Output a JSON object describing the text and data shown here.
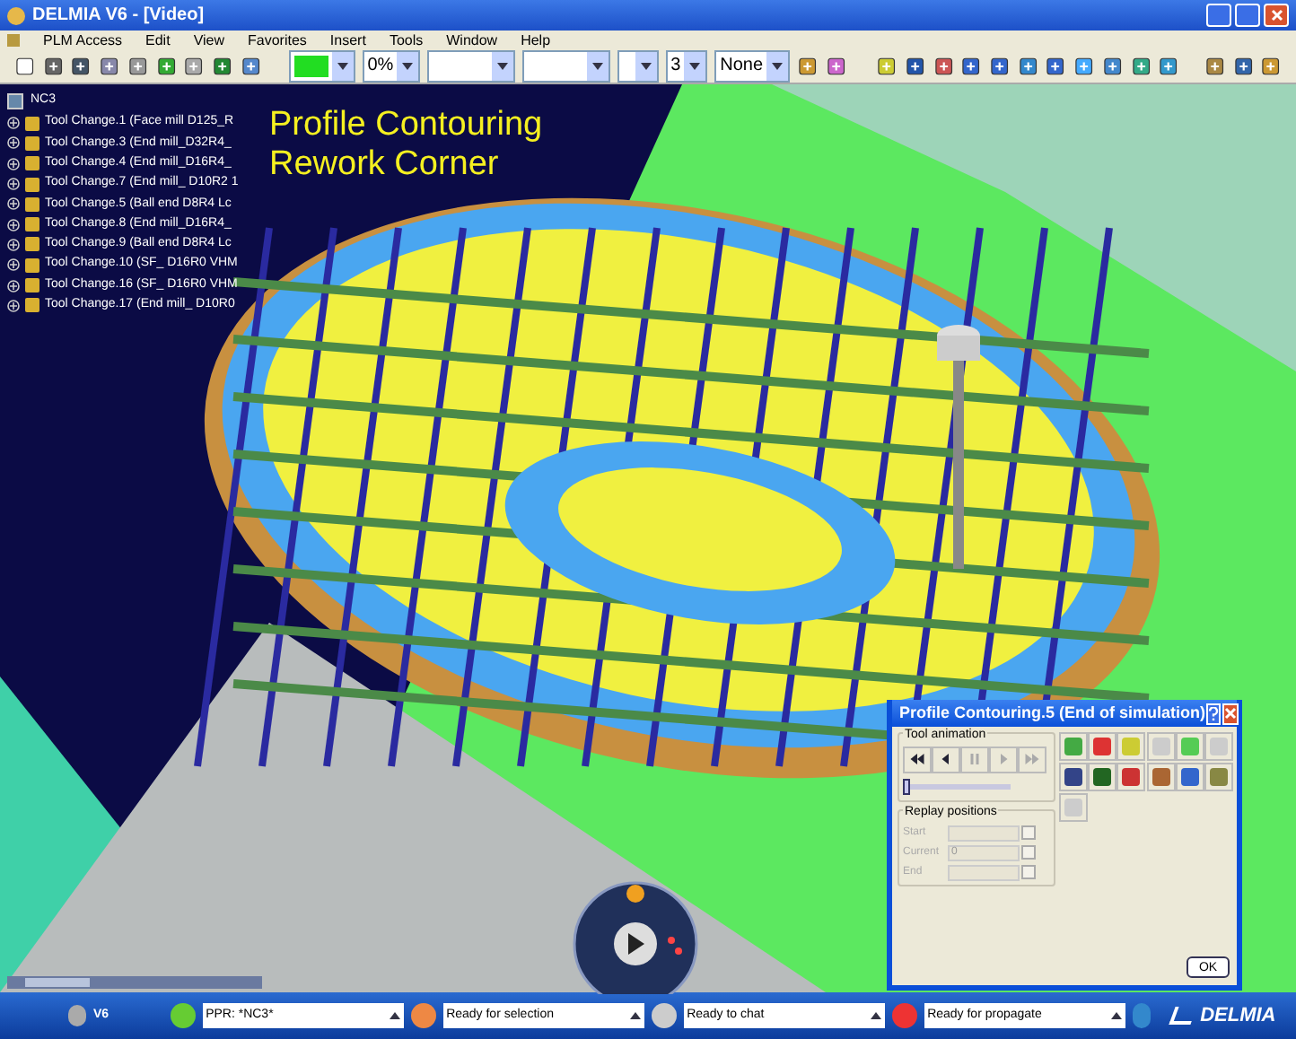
{
  "window": {
    "title": "DELMIA V6 - [Video]"
  },
  "menu": [
    {
      "label": "PLM Access"
    },
    {
      "label": "Edit"
    },
    {
      "label": "View"
    },
    {
      "label": "Favorites"
    },
    {
      "label": "Insert"
    },
    {
      "label": "Tools"
    },
    {
      "label": "Window"
    },
    {
      "label": "Help"
    }
  ],
  "toolbar": {
    "transparency": "0%",
    "line_weight": "3",
    "line_type": "None"
  },
  "tree": {
    "label": "NC3",
    "children": [
      {
        "label": "Tool Change.1 (Face mill D125_R",
        "expanded": false
      },
      {
        "label": "Tool Change.3 (End mill_D32R4_",
        "expanded": false
      },
      {
        "label": "Tool Change.4 (End mill_D16R4_",
        "expanded": false
      },
      {
        "label": "Tool Change.7 (End mill_ D10R2 1",
        "expanded": false
      },
      {
        "label": "Tool Change.5 (Ball end D8R4 Lc",
        "expanded": false
      },
      {
        "label": "Tool Change.8 (End mill_D16R4_",
        "expanded": false
      },
      {
        "label": "Tool Change.9 (Ball end D8R4 Lc",
        "expanded": false
      },
      {
        "label": "Tool Change.10 (SF_ D16R0 VHM",
        "expanded": false
      },
      {
        "label": "Tool Change.16 (SF_ D16R0 VHM",
        "expanded": false
      },
      {
        "label": "Tool Change.17 (End mill_ D10R0",
        "expanded": false
      }
    ]
  },
  "annotation": [
    "Profile Contouring",
    "Rework Corner"
  ],
  "dialog": {
    "title": "Profile Contouring.5 (End of simulation)",
    "tool_animation": {
      "label": "Tool animation",
      "buttons": [
        {
          "disabled": false
        },
        {
          "disabled": false
        },
        {
          "disabled": true
        },
        {
          "disabled": true
        },
        {
          "disabled": true
        }
      ],
      "level": 0
    },
    "replay": {
      "label": "Replay positions",
      "fields": [
        {
          "label": "Start",
          "disabled": true
        },
        {
          "label": "Current",
          "value": "0",
          "disabled": true
        },
        {
          "label": "End",
          "disabled": true
        }
      ]
    },
    "tools": [
      {
        "disabled": false
      },
      {
        "disabled": false
      },
      {
        "disabled": false
      },
      {
        "disabled": true
      },
      {
        "disabled": false
      },
      {
        "disabled": true
      },
      {
        "disabled": false
      },
      {
        "disabled": false
      },
      {
        "disabled": false
      },
      {
        "disabled": false
      },
      {
        "disabled": false
      },
      {
        "disabled": false
      },
      {
        "disabled": true
      }
    ],
    "ok": "OK"
  },
  "status_bar": {
    "logo": "V6",
    "fields": [
      "PPR: *NC3*",
      "Ready for selection",
      "Ready to chat",
      "Ready for propagate"
    ],
    "brand": "DELMIA"
  }
}
